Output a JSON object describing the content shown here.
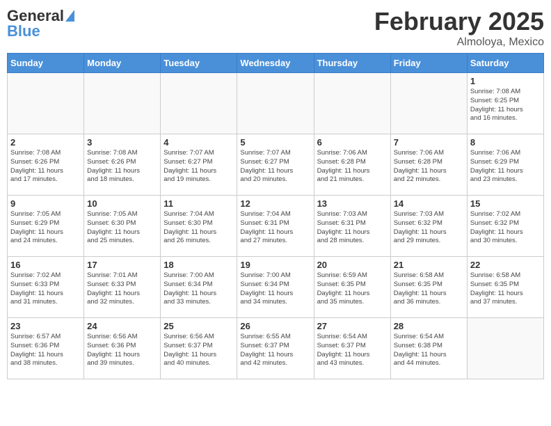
{
  "header": {
    "logo_general": "General",
    "logo_blue": "Blue",
    "month": "February 2025",
    "location": "Almoloya, Mexico"
  },
  "days_of_week": [
    "Sunday",
    "Monday",
    "Tuesday",
    "Wednesday",
    "Thursday",
    "Friday",
    "Saturday"
  ],
  "weeks": [
    [
      {
        "day": "",
        "info": ""
      },
      {
        "day": "",
        "info": ""
      },
      {
        "day": "",
        "info": ""
      },
      {
        "day": "",
        "info": ""
      },
      {
        "day": "",
        "info": ""
      },
      {
        "day": "",
        "info": ""
      },
      {
        "day": "1",
        "info": "Sunrise: 7:08 AM\nSunset: 6:25 PM\nDaylight: 11 hours\nand 16 minutes."
      }
    ],
    [
      {
        "day": "2",
        "info": "Sunrise: 7:08 AM\nSunset: 6:26 PM\nDaylight: 11 hours\nand 17 minutes."
      },
      {
        "day": "3",
        "info": "Sunrise: 7:08 AM\nSunset: 6:26 PM\nDaylight: 11 hours\nand 18 minutes."
      },
      {
        "day": "4",
        "info": "Sunrise: 7:07 AM\nSunset: 6:27 PM\nDaylight: 11 hours\nand 19 minutes."
      },
      {
        "day": "5",
        "info": "Sunrise: 7:07 AM\nSunset: 6:27 PM\nDaylight: 11 hours\nand 20 minutes."
      },
      {
        "day": "6",
        "info": "Sunrise: 7:06 AM\nSunset: 6:28 PM\nDaylight: 11 hours\nand 21 minutes."
      },
      {
        "day": "7",
        "info": "Sunrise: 7:06 AM\nSunset: 6:28 PM\nDaylight: 11 hours\nand 22 minutes."
      },
      {
        "day": "8",
        "info": "Sunrise: 7:06 AM\nSunset: 6:29 PM\nDaylight: 11 hours\nand 23 minutes."
      }
    ],
    [
      {
        "day": "9",
        "info": "Sunrise: 7:05 AM\nSunset: 6:29 PM\nDaylight: 11 hours\nand 24 minutes."
      },
      {
        "day": "10",
        "info": "Sunrise: 7:05 AM\nSunset: 6:30 PM\nDaylight: 11 hours\nand 25 minutes."
      },
      {
        "day": "11",
        "info": "Sunrise: 7:04 AM\nSunset: 6:30 PM\nDaylight: 11 hours\nand 26 minutes."
      },
      {
        "day": "12",
        "info": "Sunrise: 7:04 AM\nSunset: 6:31 PM\nDaylight: 11 hours\nand 27 minutes."
      },
      {
        "day": "13",
        "info": "Sunrise: 7:03 AM\nSunset: 6:31 PM\nDaylight: 11 hours\nand 28 minutes."
      },
      {
        "day": "14",
        "info": "Sunrise: 7:03 AM\nSunset: 6:32 PM\nDaylight: 11 hours\nand 29 minutes."
      },
      {
        "day": "15",
        "info": "Sunrise: 7:02 AM\nSunset: 6:32 PM\nDaylight: 11 hours\nand 30 minutes."
      }
    ],
    [
      {
        "day": "16",
        "info": "Sunrise: 7:02 AM\nSunset: 6:33 PM\nDaylight: 11 hours\nand 31 minutes."
      },
      {
        "day": "17",
        "info": "Sunrise: 7:01 AM\nSunset: 6:33 PM\nDaylight: 11 hours\nand 32 minutes."
      },
      {
        "day": "18",
        "info": "Sunrise: 7:00 AM\nSunset: 6:34 PM\nDaylight: 11 hours\nand 33 minutes."
      },
      {
        "day": "19",
        "info": "Sunrise: 7:00 AM\nSunset: 6:34 PM\nDaylight: 11 hours\nand 34 minutes."
      },
      {
        "day": "20",
        "info": "Sunrise: 6:59 AM\nSunset: 6:35 PM\nDaylight: 11 hours\nand 35 minutes."
      },
      {
        "day": "21",
        "info": "Sunrise: 6:58 AM\nSunset: 6:35 PM\nDaylight: 11 hours\nand 36 minutes."
      },
      {
        "day": "22",
        "info": "Sunrise: 6:58 AM\nSunset: 6:35 PM\nDaylight: 11 hours\nand 37 minutes."
      }
    ],
    [
      {
        "day": "23",
        "info": "Sunrise: 6:57 AM\nSunset: 6:36 PM\nDaylight: 11 hours\nand 38 minutes."
      },
      {
        "day": "24",
        "info": "Sunrise: 6:56 AM\nSunset: 6:36 PM\nDaylight: 11 hours\nand 39 minutes."
      },
      {
        "day": "25",
        "info": "Sunrise: 6:56 AM\nSunset: 6:37 PM\nDaylight: 11 hours\nand 40 minutes."
      },
      {
        "day": "26",
        "info": "Sunrise: 6:55 AM\nSunset: 6:37 PM\nDaylight: 11 hours\nand 42 minutes."
      },
      {
        "day": "27",
        "info": "Sunrise: 6:54 AM\nSunset: 6:37 PM\nDaylight: 11 hours\nand 43 minutes."
      },
      {
        "day": "28",
        "info": "Sunrise: 6:54 AM\nSunset: 6:38 PM\nDaylight: 11 hours\nand 44 minutes."
      },
      {
        "day": "",
        "info": ""
      }
    ]
  ]
}
